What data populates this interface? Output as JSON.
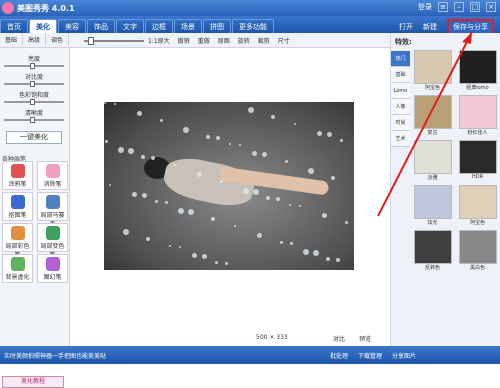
{
  "window": {
    "title": "美图秀秀 4.0.1",
    "user_label": "登录"
  },
  "menu": {
    "tabs": [
      "首页",
      "美化",
      "美容",
      "饰品",
      "文字",
      "边框",
      "场景",
      "拼图",
      "更多功能"
    ],
    "open_label": "打开",
    "new_label": "新建",
    "save_label": "保存与分享"
  },
  "subtabs": [
    "基础",
    "高级",
    "调色"
  ],
  "toolbar": {
    "zoom": "1:1原大",
    "items": [
      "撤销",
      "重做",
      "原图",
      "旋转",
      "裁剪",
      "尺寸"
    ]
  },
  "adjustments": [
    "亮度",
    "对比度",
    "色彩饱和度",
    "清晰度"
  ],
  "one_key_label": "一键美化",
  "pen_section": "各种画笔",
  "pens": [
    {
      "label": "涂鸦笔",
      "color": "#e05050"
    },
    {
      "label": "消除笔",
      "color": "#f0a0c0"
    },
    {
      "label": "抠图笔",
      "color": "#3a6ad0"
    },
    {
      "label": "局部马赛克",
      "color": "#5080c0"
    },
    {
      "label": "局部彩色笔",
      "color": "#e09040"
    },
    {
      "label": "局部变色笔",
      "color": "#40a060"
    },
    {
      "label": "背景虚化",
      "color": "#60b060"
    },
    {
      "label": "魔幻笔",
      "color": "#b060d0"
    }
  ],
  "tutorial_label": "美化教程",
  "image_info": {
    "size": "500 × 333",
    "compare_label": "对比",
    "preview_label": "预览"
  },
  "effects_title": "特效:",
  "effect_categories": [
    "热门",
    "基础",
    "Lomo",
    "人像",
    "时尚",
    "艺术"
  ],
  "effects": [
    {
      "label": "阿宝色",
      "color": "#d8c8b0"
    },
    {
      "label": "经典lomo",
      "color": "#202020"
    },
    {
      "label": "复古",
      "color": "#b8a078"
    },
    {
      "label": "粉红佳人",
      "color": "#f0c8d8"
    },
    {
      "label": "淡雅",
      "color": "#e0e0d8"
    },
    {
      "label": "HDR",
      "color": "#2a2a2a"
    },
    {
      "label": "炫光",
      "color": "#c0c8e0"
    },
    {
      "label": "阿宝色",
      "color": "#e0d0b8"
    },
    {
      "label": "反转色",
      "color": "#404040"
    },
    {
      "label": "黑白色",
      "color": "#888888"
    }
  ],
  "status": {
    "tip": "实时美颜拍照神器一手把图也能美美哒",
    "buttons": [
      "批处理",
      "下载管理",
      "分享图片"
    ]
  }
}
